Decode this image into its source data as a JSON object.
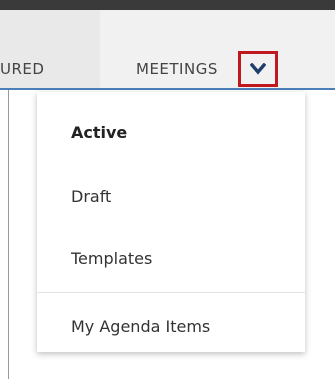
{
  "nav": {
    "featured_partial": "URED",
    "meetings_label": "MEETINGS",
    "chevron_icon": "chevron-down-icon",
    "highlight_color": "#c0181f",
    "accent_color": "#4a7fb8"
  },
  "dropdown": {
    "items": [
      {
        "label": "Active"
      },
      {
        "label": "Draft"
      },
      {
        "label": "Templates"
      },
      {
        "label": "My Agenda Items"
      }
    ]
  }
}
